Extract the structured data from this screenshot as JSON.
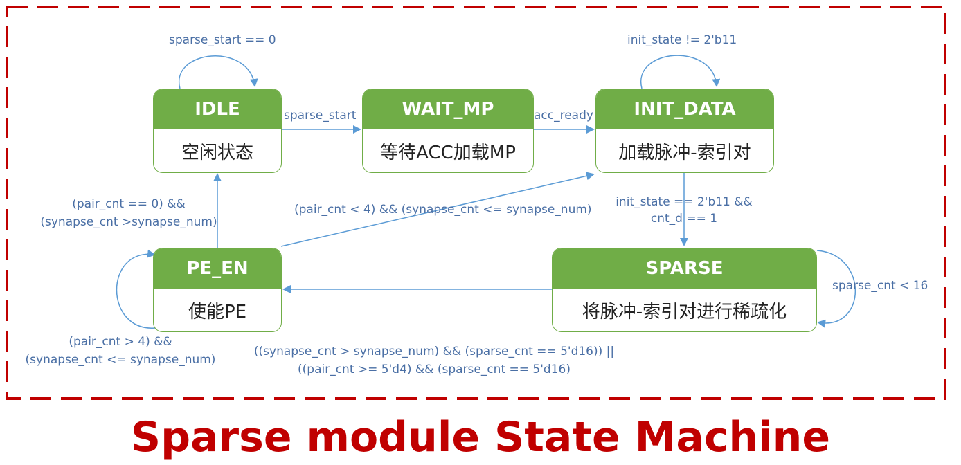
{
  "title": "Sparse module State Machine",
  "states": {
    "idle": {
      "name": "IDLE",
      "desc": "空闲状态"
    },
    "wait_mp": {
      "name": "WAIT_MP",
      "desc": "等待ACC加载MP"
    },
    "init_data": {
      "name": "INIT_DATA",
      "desc": "加载脉冲-索引对"
    },
    "sparse": {
      "name": "SPARSE",
      "desc": "将脉冲-索引对进行稀疏化"
    },
    "pe_en": {
      "name": "PE_EN",
      "desc": "使能PE"
    }
  },
  "transitions": {
    "idle_self": "sparse_start == 0",
    "idle_to_wait": "sparse_start",
    "wait_to_init": "acc_ready",
    "init_self": "init_state != 2'b11",
    "init_to_sparse_l1": "init_state == 2'b11 &&",
    "init_to_sparse_l2": "cnt_d == 1",
    "sparse_self": "sparse_cnt < 16",
    "sparse_to_pe_l1": "((synapse_cnt > synapse_num) && (sparse_cnt == 5'd16)) ||",
    "sparse_to_pe_l2": "((pair_cnt >= 5'd4) && (sparse_cnt == 5'd16)",
    "pe_to_idle_l1": "(pair_cnt == 0) &&",
    "pe_to_idle_l2": "(synapse_cnt >synapse_num)",
    "pe_to_init": "(pair_cnt < 4) && (synapse_cnt <= synapse_num)",
    "pe_self_l1": "(pair_cnt > 4) &&",
    "pe_self_l2": "(synapse_cnt <= synapse_num)"
  },
  "colors": {
    "state_fill": "#70ad47",
    "arrow": "#5b9bd5",
    "label": "#4a6fa5",
    "frame": "#c00000",
    "title": "#c00000"
  }
}
